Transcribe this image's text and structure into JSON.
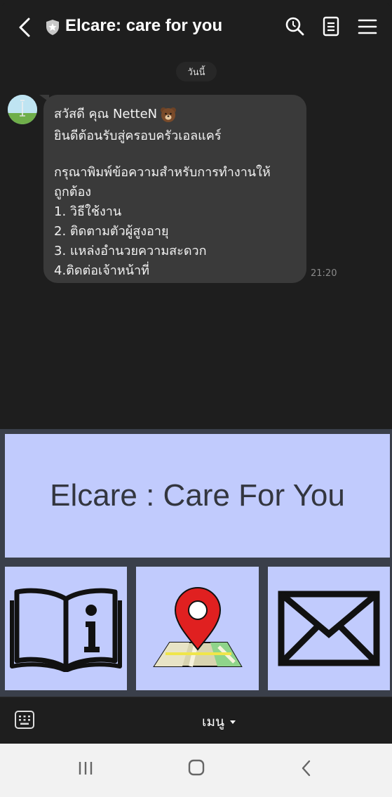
{
  "header": {
    "title": "Elcare: care for you",
    "back_icon": "chevron-left-icon",
    "badge_icon": "shield-star-icon",
    "search_icon": "search-icon",
    "notes_icon": "notes-icon",
    "menu_icon": "hamburger-menu-icon"
  },
  "chat": {
    "date_label": "วันนี้",
    "message": {
      "lines": [
        "สวัสดี คุณ NetteN",
        "ยินดีต้อนรับสู่ครอบครัวเอลแคร์",
        "กรุณาพิมพ์ข้อความสำหรับการทำงานให้",
        "ถูกต้อง",
        "1. วิธีใช้งาน",
        "2. ติดตามตัวผู้สูงอายุ",
        "3. แหล่งอำนวยความสะดวก",
        "4.ติดต่อเจ้าหน้าที่"
      ],
      "time": "21:20"
    }
  },
  "rich_menu": {
    "banner_text": "Elcare : Care For You",
    "tiles": [
      {
        "icon": "book-info-icon"
      },
      {
        "icon": "map-pin-icon"
      },
      {
        "icon": "envelope-icon"
      }
    ],
    "colors": {
      "tile_bg": "#c1cbfd",
      "divider": "#3a3f4a",
      "pin": "#e02020"
    }
  },
  "bottom_bar": {
    "keyboard_icon": "keyboard-icon",
    "menu_label": "เมนู"
  },
  "navbar": {
    "recents_icon": "recents-icon",
    "home_icon": "home-icon",
    "back_icon": "back-icon"
  }
}
